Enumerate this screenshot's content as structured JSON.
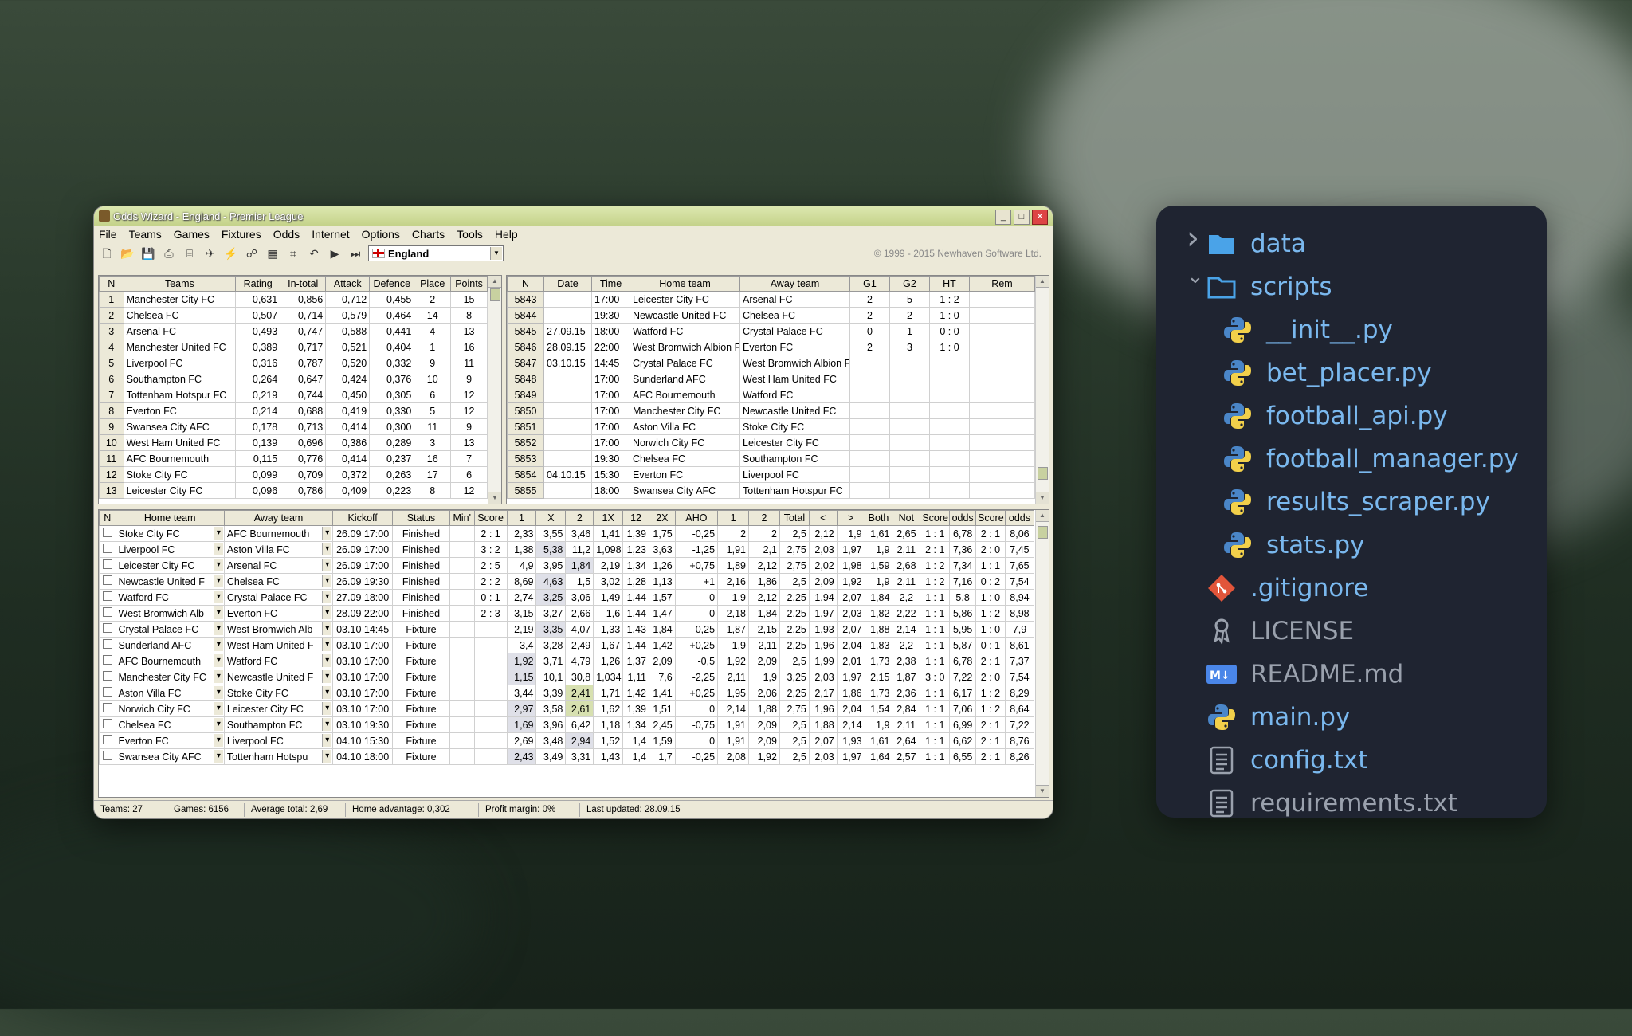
{
  "window": {
    "title": "Odds Wizard - England - Premier League",
    "menu": [
      "File",
      "Teams",
      "Games",
      "Fixtures",
      "Odds",
      "Internet",
      "Options",
      "Charts",
      "Tools",
      "Help"
    ],
    "country": "England",
    "copyright": "© 1999 - 2015 Newhaven Software Ltd."
  },
  "teams_table": {
    "headers": [
      "N",
      "Teams",
      "Rating",
      "In-total",
      "Attack",
      "Defence",
      "Place",
      "Points"
    ],
    "rows": [
      [
        "1",
        "Manchester City FC",
        "0,631",
        "0,856",
        "0,712",
        "0,455",
        "2",
        "15"
      ],
      [
        "2",
        "Chelsea FC",
        "0,507",
        "0,714",
        "0,579",
        "0,464",
        "14",
        "8"
      ],
      [
        "3",
        "Arsenal FC",
        "0,493",
        "0,747",
        "0,588",
        "0,441",
        "4",
        "13"
      ],
      [
        "4",
        "Manchester United FC",
        "0,389",
        "0,717",
        "0,521",
        "0,404",
        "1",
        "16"
      ],
      [
        "5",
        "Liverpool FC",
        "0,316",
        "0,787",
        "0,520",
        "0,332",
        "9",
        "11"
      ],
      [
        "6",
        "Southampton FC",
        "0,264",
        "0,647",
        "0,424",
        "0,376",
        "10",
        "9"
      ],
      [
        "7",
        "Tottenham Hotspur FC",
        "0,219",
        "0,744",
        "0,450",
        "0,305",
        "6",
        "12"
      ],
      [
        "8",
        "Everton FC",
        "0,214",
        "0,688",
        "0,419",
        "0,330",
        "5",
        "12"
      ],
      [
        "9",
        "Swansea City AFC",
        "0,178",
        "0,713",
        "0,414",
        "0,300",
        "11",
        "9"
      ],
      [
        "10",
        "West Ham United FC",
        "0,139",
        "0,696",
        "0,386",
        "0,289",
        "3",
        "13"
      ],
      [
        "11",
        "AFC Bournemouth",
        "0,115",
        "0,776",
        "0,414",
        "0,237",
        "16",
        "7"
      ],
      [
        "12",
        "Stoke City FC",
        "0,099",
        "0,709",
        "0,372",
        "0,263",
        "17",
        "6"
      ],
      [
        "13",
        "Leicester City FC",
        "0,096",
        "0,786",
        "0,409",
        "0,223",
        "8",
        "12"
      ]
    ]
  },
  "games_table": {
    "headers": [
      "N",
      "Date",
      "Time",
      "Home team",
      "Away team",
      "G1",
      "G2",
      "HT",
      "Rem"
    ],
    "rows": [
      [
        "5843",
        "",
        "17:00",
        "Leicester City FC",
        "Arsenal FC",
        "2",
        "5",
        "1 : 2",
        ""
      ],
      [
        "5844",
        "",
        "19:30",
        "Newcastle United FC",
        "Chelsea FC",
        "2",
        "2",
        "1 : 0",
        ""
      ],
      [
        "5845",
        "27.09.15",
        "18:00",
        "Watford FC",
        "Crystal Palace FC",
        "0",
        "1",
        "0 : 0",
        ""
      ],
      [
        "5846",
        "28.09.15",
        "22:00",
        "West Bromwich Albion F",
        "Everton FC",
        "2",
        "3",
        "1 : 0",
        ""
      ],
      [
        "5847",
        "03.10.15",
        "14:45",
        "Crystal Palace FC",
        "West Bromwich Albion F",
        "",
        "",
        "",
        ""
      ],
      [
        "5848",
        "",
        "17:00",
        "Sunderland AFC",
        "West Ham United FC",
        "",
        "",
        "",
        ""
      ],
      [
        "5849",
        "",
        "17:00",
        "AFC Bournemouth",
        "Watford FC",
        "",
        "",
        "",
        ""
      ],
      [
        "5850",
        "",
        "17:00",
        "Manchester City FC",
        "Newcastle United FC",
        "",
        "",
        "",
        ""
      ],
      [
        "5851",
        "",
        "17:00",
        "Aston Villa FC",
        "Stoke City FC",
        "",
        "",
        "",
        ""
      ],
      [
        "5852",
        "",
        "17:00",
        "Norwich City FC",
        "Leicester City FC",
        "",
        "",
        "",
        ""
      ],
      [
        "5853",
        "",
        "19:30",
        "Chelsea FC",
        "Southampton FC",
        "",
        "",
        "",
        ""
      ],
      [
        "5854",
        "04.10.15",
        "15:30",
        "Everton FC",
        "Liverpool FC",
        "",
        "",
        "",
        ""
      ],
      [
        "5855",
        "",
        "18:00",
        "Swansea City AFC",
        "Tottenham Hotspur FC",
        "",
        "",
        "",
        ""
      ]
    ]
  },
  "fixtures_table": {
    "headers": [
      "N",
      "Home team",
      "Away team",
      "Kickoff",
      "Status",
      "Min'",
      "Score",
      "1",
      "X",
      "2",
      "1X",
      "12",
      "2X",
      "AHO",
      "1",
      "2",
      "Total",
      "<",
      ">",
      "Both",
      "Not",
      "Score",
      "odds",
      "Score",
      "odds"
    ],
    "rows": [
      [
        "Stoke City FC",
        "AFC Bournemouth",
        "26.09 17:00",
        "Finished",
        "",
        "2 : 1",
        "2,33",
        "3,55",
        "3,46",
        "1,41",
        "1,39",
        "1,75",
        "-0,25",
        "2",
        "2",
        "2,5",
        "2,12",
        "1,9",
        "1,61",
        "2,65",
        "1 : 1",
        "6,78",
        "2 : 1",
        "8,06"
      ],
      [
        "Liverpool FC",
        "Aston Villa FC",
        "26.09 17:00",
        "Finished",
        "",
        "3 : 2",
        "1,38",
        "5,38",
        "11,2",
        "1,098",
        "1,23",
        "3,63",
        "-1,25",
        "1,91",
        "2,1",
        "2,75",
        "2,03",
        "1,97",
        "1,9",
        "2,11",
        "2 : 1",
        "7,36",
        "2 : 0",
        "7,45"
      ],
      [
        "Leicester City FC",
        "Arsenal FC",
        "26.09 17:00",
        "Finished",
        "",
        "2 : 5",
        "4,9",
        "3,95",
        "1,84",
        "2,19",
        "1,34",
        "1,26",
        "+0,75",
        "1,89",
        "2,12",
        "2,75",
        "2,02",
        "1,98",
        "1,59",
        "2,68",
        "1 : 2",
        "7,34",
        "1 : 1",
        "7,65"
      ],
      [
        "Newcastle United F",
        "Chelsea FC",
        "26.09 19:30",
        "Finished",
        "",
        "2 : 2",
        "8,69",
        "4,63",
        "1,5",
        "3,02",
        "1,28",
        "1,13",
        "+1",
        "2,16",
        "1,86",
        "2,5",
        "2,09",
        "1,92",
        "1,9",
        "2,11",
        "1 : 2",
        "7,16",
        "0 : 2",
        "7,54"
      ],
      [
        "Watford FC",
        "Crystal Palace FC",
        "27.09 18:00",
        "Finished",
        "",
        "0 : 1",
        "2,74",
        "3,25",
        "3,06",
        "1,49",
        "1,44",
        "1,57",
        "0",
        "1,9",
        "2,12",
        "2,25",
        "1,94",
        "2,07",
        "1,84",
        "2,2",
        "1 : 1",
        "5,8",
        "1 : 0",
        "8,94"
      ],
      [
        "West Bromwich Alb",
        "Everton FC",
        "28.09 22:00",
        "Finished",
        "",
        "2 : 3",
        "3,15",
        "3,27",
        "2,66",
        "1,6",
        "1,44",
        "1,47",
        "0",
        "2,18",
        "1,84",
        "2,25",
        "1,97",
        "2,03",
        "1,82",
        "2,22",
        "1 : 1",
        "5,86",
        "1 : 2",
        "8,98"
      ],
      [
        "Crystal Palace FC",
        "West Bromwich Alb",
        "03.10 14:45",
        "Fixture",
        "",
        "",
        "2,19",
        "3,35",
        "4,07",
        "1,33",
        "1,43",
        "1,84",
        "-0,25",
        "1,87",
        "2,15",
        "2,25",
        "1,93",
        "2,07",
        "1,88",
        "2,14",
        "1 : 1",
        "5,95",
        "1 : 0",
        "7,9"
      ],
      [
        "Sunderland AFC",
        "West Ham United F",
        "03.10 17:00",
        "Fixture",
        "",
        "",
        "3,4",
        "3,28",
        "2,49",
        "1,67",
        "1,44",
        "1,42",
        "+0,25",
        "1,9",
        "2,11",
        "2,25",
        "1,96",
        "2,04",
        "1,83",
        "2,2",
        "1 : 1",
        "5,87",
        "0 : 1",
        "8,61"
      ],
      [
        "AFC Bournemouth",
        "Watford FC",
        "03.10 17:00",
        "Fixture",
        "",
        "",
        "1,92",
        "3,71",
        "4,79",
        "1,26",
        "1,37",
        "2,09",
        "-0,5",
        "1,92",
        "2,09",
        "2,5",
        "1,99",
        "2,01",
        "1,73",
        "2,38",
        "1 : 1",
        "6,78",
        "2 : 1",
        "7,37"
      ],
      [
        "Manchester City FC",
        "Newcastle United F",
        "03.10 17:00",
        "Fixture",
        "",
        "",
        "1,15",
        "10,1",
        "30,8",
        "1,034",
        "1,11",
        "7,6",
        "-2,25",
        "2,11",
        "1,9",
        "3,25",
        "2,03",
        "1,97",
        "2,15",
        "1,87",
        "3 : 0",
        "7,22",
        "2 : 0",
        "7,54"
      ],
      [
        "Aston Villa FC",
        "Stoke City FC",
        "03.10 17:00",
        "Fixture",
        "",
        "",
        "3,44",
        "3,39",
        "2,41",
        "1,71",
        "1,42",
        "1,41",
        "+0,25",
        "1,95",
        "2,06",
        "2,25",
        "2,17",
        "1,86",
        "1,73",
        "2,36",
        "1 : 1",
        "6,17",
        "1 : 2",
        "8,29"
      ],
      [
        "Norwich City FC",
        "Leicester City FC",
        "03.10 17:00",
        "Fixture",
        "",
        "",
        "2,97",
        "3,58",
        "2,61",
        "1,62",
        "1,39",
        "1,51",
        "0",
        "2,14",
        "1,88",
        "2,75",
        "1,96",
        "2,04",
        "1,54",
        "2,84",
        "1 : 1",
        "7,06",
        "1 : 2",
        "8,64"
      ],
      [
        "Chelsea FC",
        "Southampton FC",
        "03.10 19:30",
        "Fixture",
        "",
        "",
        "1,69",
        "3,96",
        "6,42",
        "1,18",
        "1,34",
        "2,45",
        "-0,75",
        "1,91",
        "2,09",
        "2,5",
        "1,88",
        "2,14",
        "1,9",
        "2,11",
        "1 : 1",
        "6,99",
        "2 : 1",
        "7,22"
      ],
      [
        "Everton FC",
        "Liverpool FC",
        "04.10 15:30",
        "Fixture",
        "",
        "",
        "2,69",
        "3,48",
        "2,94",
        "1,52",
        "1,4",
        "1,59",
        "0",
        "1,91",
        "2,09",
        "2,5",
        "2,07",
        "1,93",
        "1,61",
        "2,64",
        "1 : 1",
        "6,62",
        "2 : 1",
        "8,76"
      ],
      [
        "Swansea City AFC",
        "Tottenham Hotspu",
        "04.10 18:00",
        "Fixture",
        "",
        "",
        "2,43",
        "3,49",
        "3,31",
        "1,43",
        "1,4",
        "1,7",
        "-0,25",
        "2,08",
        "1,92",
        "2,5",
        "2,03",
        "1,97",
        "1,64",
        "2,57",
        "1 : 1",
        "6,55",
        "2 : 1",
        "8,26"
      ]
    ]
  },
  "statusbar": {
    "teams": "Teams: 27",
    "games": "Games: 6156",
    "avg_total": "Average total: 2,69",
    "home_adv": "Home advantage: 0,302",
    "profit": "Profit margin: 0%",
    "updated": "Last updated: 28.09.15"
  },
  "explorer": {
    "items": [
      {
        "label": "data",
        "icon": "folder-icon",
        "chevron": "right"
      },
      {
        "label": "scripts",
        "icon": "folder-open-icon",
        "chevron": "down"
      },
      {
        "label": "__init__.py",
        "icon": "python-icon"
      },
      {
        "label": "bet_placer.py",
        "icon": "python-icon"
      },
      {
        "label": "football_api.py",
        "icon": "python-icon"
      },
      {
        "label": "football_manager.py",
        "icon": "python-icon"
      },
      {
        "label": "results_scraper.py",
        "icon": "python-icon"
      },
      {
        "label": "stats.py",
        "icon": "python-icon"
      },
      {
        "label": ".gitignore",
        "icon": "git-icon"
      },
      {
        "label": "LICENSE",
        "icon": "license-icon"
      },
      {
        "label": "README.md",
        "icon": "markdown-icon"
      },
      {
        "label": "main.py",
        "icon": "python-icon"
      },
      {
        "label": "config.txt",
        "icon": "text-file-icon"
      },
      {
        "label": "requirements.txt",
        "icon": "text-file-icon"
      }
    ]
  }
}
